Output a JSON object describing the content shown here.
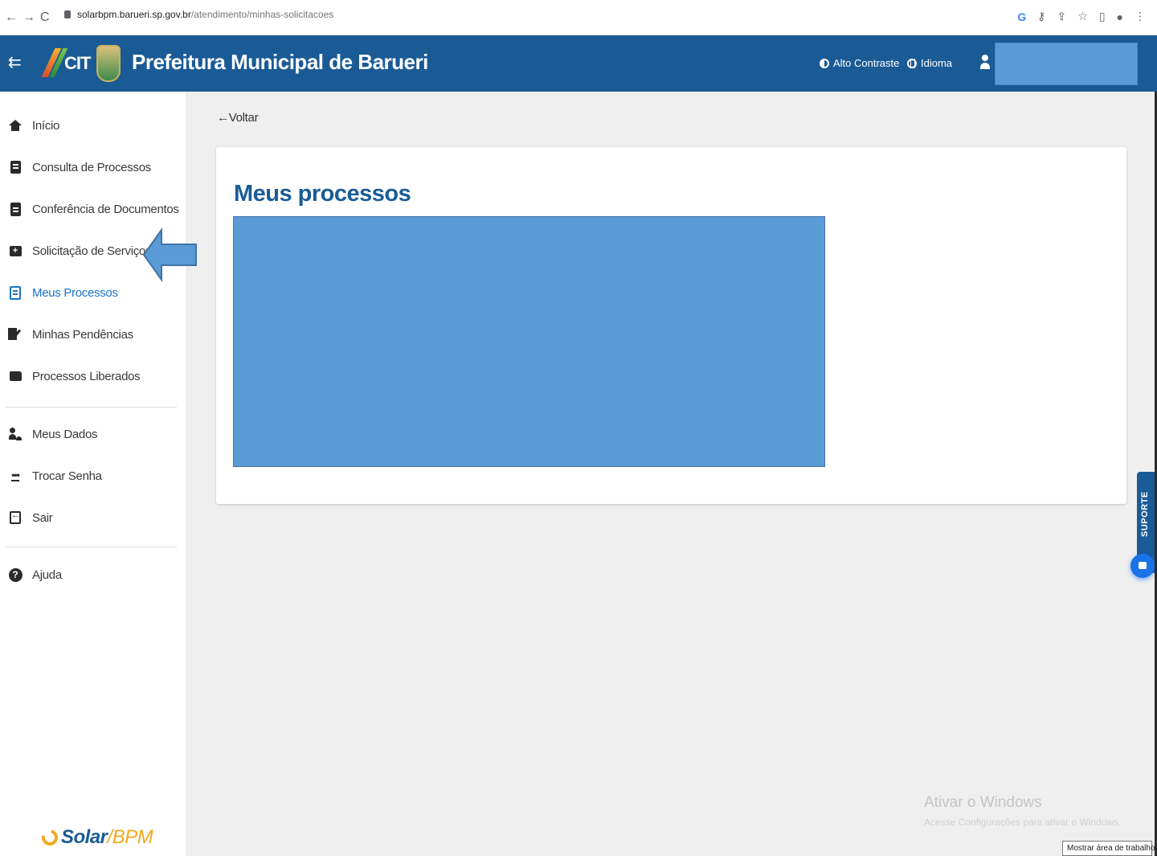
{
  "browser": {
    "url_host": "solarbpm.barueri.sp.gov.br",
    "url_path": "/atendimento/minhas-solicitacoes",
    "back_icon": "arrow-left-icon",
    "forward_icon": "arrow-right-icon",
    "reload_icon": "reload-icon"
  },
  "header": {
    "logo_text": "CIT",
    "title": "Prefeitura Municipal de Barueri",
    "contrast_label": "Alto Contraste",
    "language_label": "Idioma",
    "menu_icon": "collapse-menu-icon",
    "background_color": "#1a5b96"
  },
  "sidebar": {
    "items": [
      {
        "label": "Início",
        "icon": "home-icon"
      },
      {
        "label": "Consulta de Processos",
        "icon": "search-process-icon"
      },
      {
        "label": "Conferência de Documentos",
        "icon": "clipboard-icon"
      },
      {
        "label": "Solicitação de Serviços",
        "icon": "folder-plus-icon"
      },
      {
        "label": "Meus Processos",
        "icon": "document-icon",
        "active": true
      },
      {
        "label": "Minhas Pendências",
        "icon": "signature-icon"
      },
      {
        "label": "Processos Liberados",
        "icon": "folder-icon"
      },
      {
        "label": "Meus Dados",
        "icon": "user-gear-icon"
      },
      {
        "label": "Trocar Senha",
        "icon": "password-icon"
      },
      {
        "label": "Sair",
        "icon": "exit-icon"
      },
      {
        "label": "Ajuda",
        "icon": "help-icon"
      }
    ],
    "active_color": "#1a73c8",
    "brand": {
      "main": "Solar",
      "sub": "/BPM"
    }
  },
  "main": {
    "back_label": "Voltar",
    "card_title": "Meus processos",
    "redaction_color": "#5b9bd5"
  },
  "support": {
    "label": "SUPORTE"
  },
  "windows": {
    "watermark_title": "Ativar o Windows",
    "watermark_sub": "Acesse Configurações para ativar o Windows.",
    "tooltip": "Mostrar área de trabalho"
  }
}
